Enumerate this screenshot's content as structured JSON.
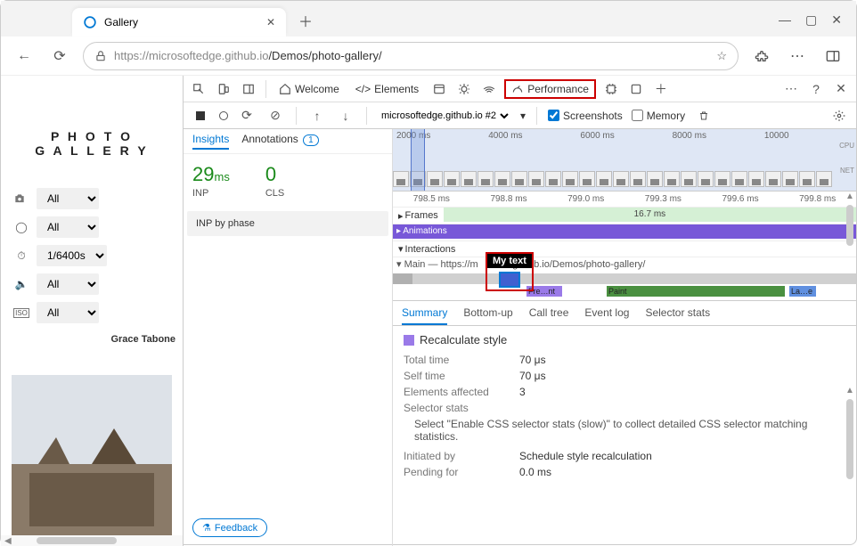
{
  "browser": {
    "tab_title": "Gallery",
    "url_prefix": "https://microsoftedge.github.io",
    "url_path": "/Demos/photo-gallery/"
  },
  "page": {
    "title_line1": "P H O T O",
    "title_line2": "G A L L E R Y",
    "filters": [
      {
        "icon": "camera-icon",
        "value": "All"
      },
      {
        "icon": "aperture-icon",
        "value": "All"
      },
      {
        "icon": "timer-icon",
        "value": "1/6400s"
      },
      {
        "icon": "speaker-icon",
        "value": "All"
      },
      {
        "icon": "iso-icon",
        "value": "All"
      }
    ],
    "photo_credit": "Grace Tabone"
  },
  "devtools": {
    "panels": {
      "welcome": "Welcome",
      "elements": "Elements",
      "performance": "Performance"
    },
    "subbar": {
      "context": "microsoftedge.github.io #2",
      "screenshots": "Screenshots",
      "memory": "Memory"
    },
    "insights": {
      "tab_insights": "Insights",
      "tab_annotations": "Annotations",
      "annotations_count": "1",
      "inp_value": "29",
      "inp_unit": "ms",
      "inp_label": "INP",
      "cls_value": "0",
      "cls_label": "CLS",
      "inp_phase": "INP by phase",
      "feedback": "Feedback"
    },
    "overview": {
      "ticks": [
        "2000 ms",
        "4000 ms",
        "6000 ms",
        "8000 ms",
        "10000"
      ],
      "cpu_label": "CPU",
      "net_label": "NET"
    },
    "ruler": [
      "798.5 ms",
      "798.8 ms",
      "799.0 ms",
      "799.3 ms",
      "799.6 ms",
      "799.8 ms"
    ],
    "tracks": {
      "frames": "Frames",
      "frames_value": "16.7 ms",
      "animations": "Animations",
      "interactions": "Interactions",
      "main_prefix": "Main — https://m",
      "main_suffix": ".github.io/Demos/photo-gallery/",
      "tooltip": "My text",
      "flame_purple": "Fre…nt",
      "flame_green": "Paint",
      "flame_blue": "La…e"
    },
    "details": {
      "tabs": {
        "summary": "Summary",
        "bottom_up": "Bottom-up",
        "call_tree": "Call tree",
        "event_log": "Event log",
        "selector_stats": "Selector stats"
      },
      "title": "Recalculate style",
      "rows": {
        "total_time_label": "Total time",
        "total_time_value": "70 μs",
        "self_time_label": "Self time",
        "self_time_value": "70 μs",
        "elements_label": "Elements affected",
        "elements_value": "3",
        "selector_label": "Selector stats",
        "selector_note": "Select \"Enable CSS selector stats (slow)\" to collect detailed CSS selector matching statistics.",
        "initiated_label": "Initiated by",
        "initiated_value": "Schedule style recalculation",
        "pending_label": "Pending for",
        "pending_value": "0.0 ms"
      }
    }
  }
}
